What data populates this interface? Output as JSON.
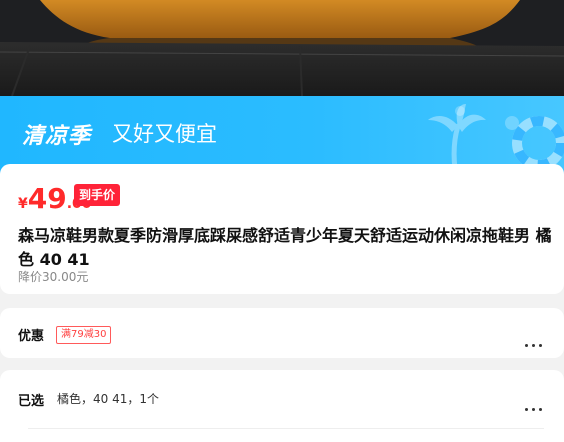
{
  "banner": {
    "title": "清凉季",
    "subtitle": "又好又便宜"
  },
  "price": {
    "currency": "¥",
    "integer": "49",
    "decimal": ".00",
    "badge": "到手价"
  },
  "product": {
    "title": "森马凉鞋男款夏季防滑厚底踩屎感舒适青少年夏天舒适运动休闲凉拖鞋男 橘色 40 41",
    "reduced_price": "降价30.00元"
  },
  "promo": {
    "label": "优惠",
    "coupon": "满79减30"
  },
  "selected": {
    "label": "已选",
    "value": "橘色，40 41，1个"
  },
  "colors": {
    "accent": "#ff2a2a",
    "banner": "#20b7ff",
    "badge_bg": "#ff2338"
  },
  "icons": {
    "more": "more-dots-icon",
    "palm": "palm-tree-icon",
    "ring": "swim-ring-icon"
  }
}
